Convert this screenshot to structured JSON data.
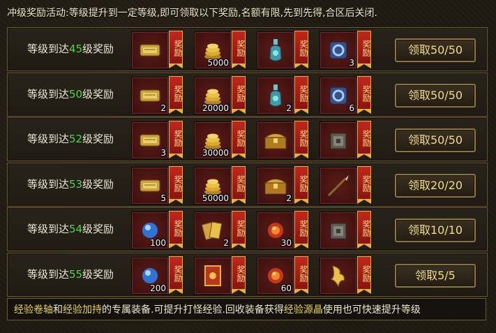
{
  "header": {
    "text": "冲级奖励活动:等级提升到一定等级,即可领取以下奖励,名额有限,先到先得,合区后关闭."
  },
  "badge_text": "奖励",
  "label_prefix": "等级到达",
  "label_suffix": "级奖励",
  "rows": [
    {
      "level": "45",
      "button": "领取50/50",
      "items": [
        {
          "icon": "scroll-icon",
          "count": ""
        },
        {
          "icon": "gold-coins-icon",
          "count": "5000"
        },
        {
          "icon": "potion-bottle-icon",
          "count": ""
        },
        {
          "icon": "rune-stone-icon",
          "count": "3"
        }
      ]
    },
    {
      "level": "50",
      "button": "领取50/50",
      "items": [
        {
          "icon": "scroll-icon",
          "count": "2"
        },
        {
          "icon": "gold-coins-icon",
          "count": "20000"
        },
        {
          "icon": "potion-bottle-icon",
          "count": "2"
        },
        {
          "icon": "rune-stone-icon",
          "count": "6"
        }
      ]
    },
    {
      "level": "52",
      "button": "领取50/50",
      "items": [
        {
          "icon": "scroll-icon",
          "count": "3"
        },
        {
          "icon": "gold-coins-icon",
          "count": "30000"
        },
        {
          "icon": "treasure-chest-icon",
          "count": ""
        },
        {
          "icon": "iron-box-icon",
          "count": ""
        }
      ]
    },
    {
      "level": "53",
      "button": "领取20/20",
      "items": [
        {
          "icon": "scroll-icon",
          "count": "5"
        },
        {
          "icon": "gold-coins-icon",
          "count": "50000"
        },
        {
          "icon": "treasure-chest-icon",
          "count": "2"
        },
        {
          "icon": "spear-icon",
          "count": ""
        }
      ]
    },
    {
      "level": "54",
      "button": "领取10/10",
      "items": [
        {
          "icon": "blue-orb-icon",
          "count": "100"
        },
        {
          "icon": "gold-scrolls-icon",
          "count": "2"
        },
        {
          "icon": "fire-orb-icon",
          "count": "30"
        },
        {
          "icon": "iron-box-icon",
          "count": ""
        }
      ]
    },
    {
      "level": "55",
      "button": "领取5/5",
      "items": [
        {
          "icon": "blue-orb-icon",
          "count": "200"
        },
        {
          "icon": "spell-book-icon",
          "count": ""
        },
        {
          "icon": "fire-orb-icon",
          "count": "60"
        },
        {
          "icon": "golden-dragon-icon",
          "count": ""
        }
      ]
    }
  ],
  "footer": {
    "part1": "经验卷轴",
    "part2": "和",
    "part3": "经验加持",
    "part4": "的专属装备.可提升打怪经验.回收装备获得",
    "part5": "经验源晶",
    "part6": "使用也可快速提升等级"
  },
  "colors": {
    "level": "#4fd64a",
    "highlight": "#e8d14a",
    "badge": "#c0271d",
    "button_text": "#f3d98a"
  }
}
